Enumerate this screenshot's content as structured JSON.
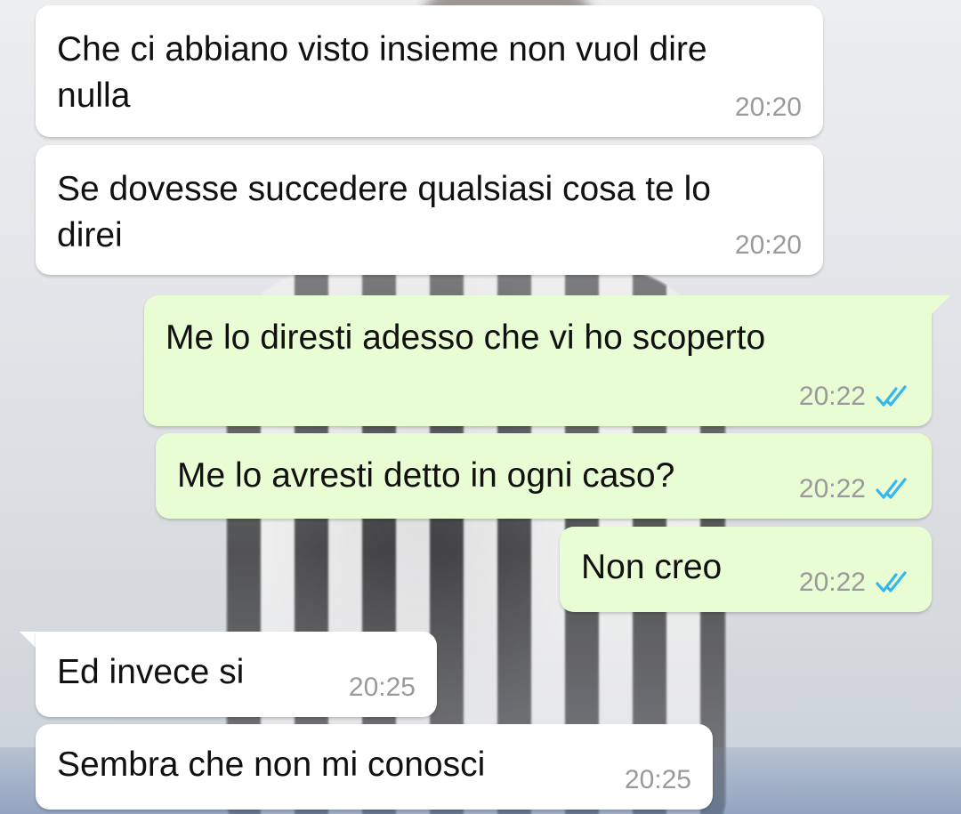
{
  "colors": {
    "incoming_bubble": "#ffffff",
    "outgoing_bubble": "#e9fdd4",
    "time_text": "#9a9a9a",
    "read_ticks": "#34b7f1",
    "message_text": "#111111"
  },
  "icons": {
    "read_receipt": "double-check-icon"
  },
  "messages": [
    {
      "direction": "incoming",
      "text": "Che ci abbiano visto insieme non vuol dire\nnulla",
      "time": "20:20"
    },
    {
      "direction": "incoming",
      "text": "Se dovesse succedere qualsiasi cosa te lo\ndirei",
      "time": "20:20"
    },
    {
      "direction": "outgoing",
      "text": "Me lo diresti adesso che vi ho scoperto",
      "time": "20:22",
      "status": "read"
    },
    {
      "direction": "outgoing",
      "text": "Me lo avresti detto in ogni caso?",
      "time": "20:22",
      "status": "read"
    },
    {
      "direction": "outgoing",
      "text": "Non creo",
      "time": "20:22",
      "status": "read"
    },
    {
      "direction": "incoming",
      "text": "Ed invece si",
      "time": "20:25"
    },
    {
      "direction": "incoming",
      "text": "Sembra che non mi conosci",
      "time": "20:25"
    }
  ]
}
